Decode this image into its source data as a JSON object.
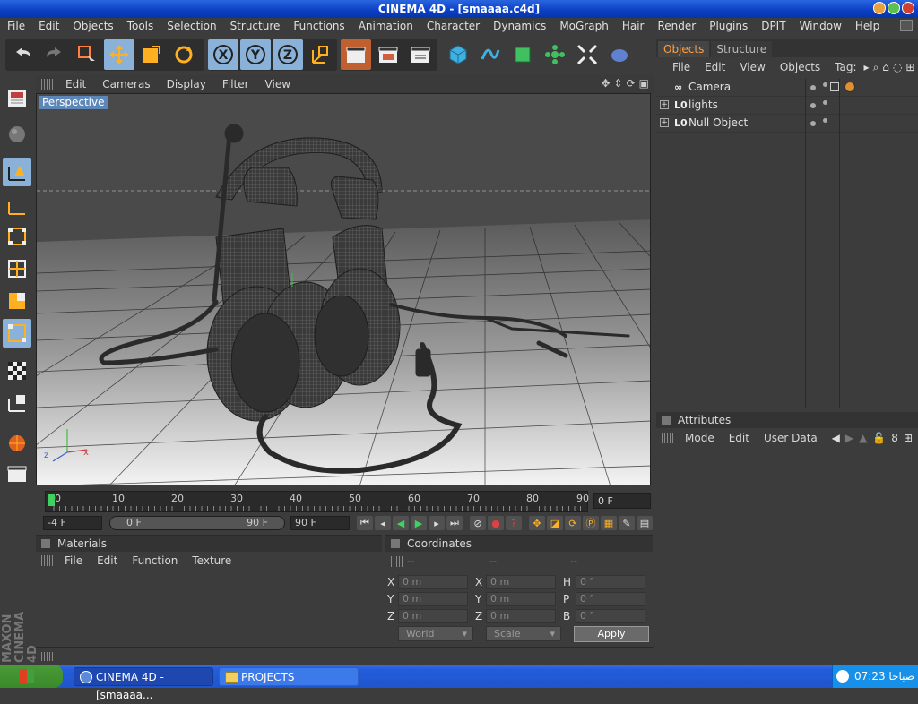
{
  "window": {
    "title": "CINEMA 4D - [smaaaa.c4d]"
  },
  "menubar": [
    "File",
    "Edit",
    "Objects",
    "Tools",
    "Selection",
    "Structure",
    "Functions",
    "Animation",
    "Character",
    "Dynamics",
    "MoGraph",
    "Hair",
    "Render",
    "Plugins",
    "DPIT",
    "Window",
    "Help"
  ],
  "viewport": {
    "menu": [
      "Edit",
      "Cameras",
      "Display",
      "Filter",
      "View"
    ],
    "label": "Perspective"
  },
  "timeline": {
    "ticks": [
      "0",
      "10",
      "20",
      "30",
      "40",
      "50",
      "60",
      "70",
      "80",
      "90"
    ],
    "current_frame": "0 F"
  },
  "transport": {
    "start_field": "-4 F",
    "range_start": "0 F",
    "range_end": "90 F",
    "end_field": "90 F"
  },
  "materials": {
    "title": "Materials",
    "menu": [
      "File",
      "Edit",
      "Function",
      "Texture"
    ]
  },
  "coordinates": {
    "title": "Coordinates",
    "headers": [
      "--",
      "--",
      "--"
    ],
    "rows": [
      {
        "l1": "X",
        "v1": "0 m",
        "l2": "X",
        "v2": "0 m",
        "l3": "H",
        "v3": "0 °"
      },
      {
        "l1": "Y",
        "v1": "0 m",
        "l2": "Y",
        "v2": "0 m",
        "l3": "P",
        "v3": "0 °"
      },
      {
        "l1": "Z",
        "v1": "0 m",
        "l2": "Z",
        "v2": "0 m",
        "l3": "B",
        "v3": "0 °"
      }
    ],
    "dropdown1": "World",
    "dropdown2": "Scale",
    "apply_label": "Apply"
  },
  "objects": {
    "tabs": [
      "Objects",
      "Structure"
    ],
    "menu": [
      "File",
      "Edit",
      "View",
      "Objects",
      "Tag:"
    ],
    "items": [
      {
        "name": "Camera",
        "icon": "camera-icon",
        "expandable": false
      },
      {
        "name": "lights",
        "icon": "null-object-icon",
        "expandable": true
      },
      {
        "name": "Null Object",
        "icon": "null-object-icon",
        "expandable": true
      }
    ]
  },
  "attributes": {
    "title": "Attributes",
    "menu": [
      "Mode",
      "Edit",
      "User Data"
    ]
  },
  "logo": "MAXON CINEMA 4D",
  "taskbar": {
    "tasks": [
      "CINEMA 4D - [smaaaa...",
      "PROJECTS"
    ],
    "clock": "07:23 صباحا"
  },
  "colors": {
    "accent": "#ffa040",
    "selected": "#8ab2d8",
    "title_bar": "#0a3ec4"
  }
}
